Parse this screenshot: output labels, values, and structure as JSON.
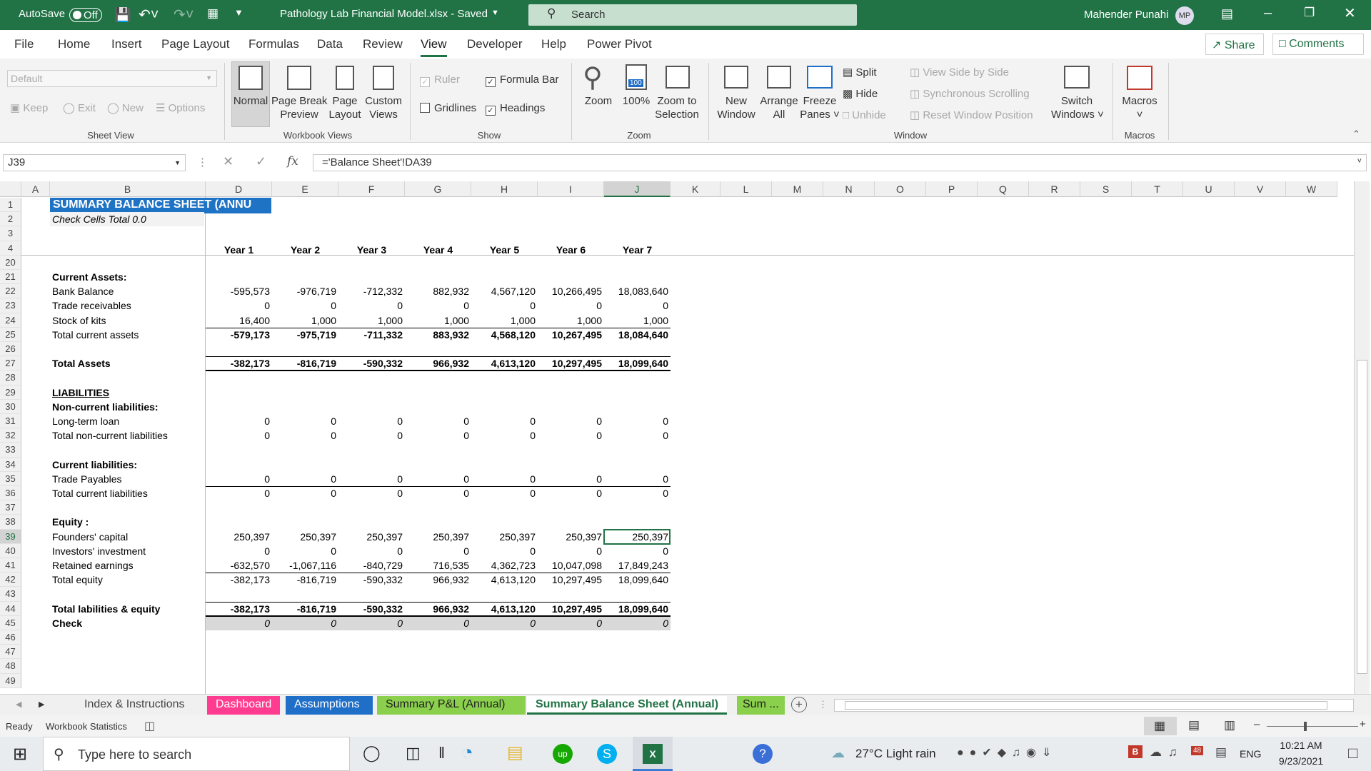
{
  "titlebar": {
    "autosave": "AutoSave",
    "autosave_state": "Off",
    "doc_title": "Pathology Lab Financial Model.xlsx  -  Saved",
    "search_placeholder": "Search",
    "user": "Mahender Punahi",
    "initials": "MP"
  },
  "menu": [
    "File",
    "Home",
    "Insert",
    "Page Layout",
    "Formulas",
    "Data",
    "Review",
    "View",
    "Developer",
    "Help",
    "Power Pivot"
  ],
  "active_menu": "View",
  "share": "Share",
  "comments": "Comments",
  "ribbon": {
    "sheet_view": {
      "dropdown": "Default",
      "keep": "Keep",
      "exit": "Exit",
      "new": "New",
      "options": "Options",
      "group": "Sheet View"
    },
    "workbook_views": {
      "normal": "Normal",
      "page_break": "Page Break",
      "page_break2": "Preview",
      "page_layout": "Page",
      "page_layout2": "Layout",
      "custom": "Custom",
      "custom2": "Views",
      "group": "Workbook Views"
    },
    "show": {
      "ruler": "Ruler",
      "formula_bar": "Formula Bar",
      "gridlines": "Gridlines",
      "headings": "Headings",
      "group": "Show"
    },
    "zoom": {
      "zoom": "Zoom",
      "hundred": "100%",
      "zoom_sel": "Zoom to",
      "zoom_sel2": "Selection",
      "icon_text": "100",
      "group": "Zoom"
    },
    "window": {
      "new": "New",
      "new2": "Window",
      "arrange": "Arrange",
      "arrange2": "All",
      "freeze": "Freeze",
      "freeze2": "Panes",
      "split": "Split",
      "hide": "Hide",
      "unhide": "Unhide",
      "side": "View Side by Side",
      "sync": "Synchronous Scrolling",
      "reset": "Reset Window Position",
      "switch": "Switch",
      "switch2": "Windows",
      "group": "Window"
    },
    "macros": {
      "label": "Macros",
      "group": "Macros"
    }
  },
  "namebox": "J39",
  "formula": "='Balance Sheet'!DA39",
  "columns": [
    "A",
    "B",
    "D",
    "E",
    "F",
    "G",
    "H",
    "I",
    "J",
    "K",
    "L",
    "M",
    "N",
    "O",
    "P",
    "Q",
    "R",
    "S",
    "T",
    "U",
    "V",
    "W"
  ],
  "rows": [
    "1",
    "2",
    "3",
    "4",
    "20",
    "21",
    "22",
    "23",
    "24",
    "25",
    "26",
    "27",
    "28",
    "29",
    "30",
    "31",
    "32",
    "33",
    "34",
    "35",
    "36",
    "37",
    "38",
    "39",
    "40",
    "41",
    "42",
    "43",
    "44",
    "45",
    "46",
    "47",
    "48",
    "49"
  ],
  "sheet": {
    "title": "SUMMARY BALANCE SHEET (ANNU",
    "check_cells": "Check Cells Total 0.0",
    "years": [
      "Year 1",
      "Year 2",
      "Year 3",
      "Year 4",
      "Year 5",
      "Year 6",
      "Year 7"
    ],
    "lines": [
      {
        "row": "21",
        "label": "Current Assets:",
        "bold": true,
        "values": []
      },
      {
        "row": "22",
        "label": "Bank Balance",
        "values": [
          "-595,573",
          "-976,719",
          "-712,332",
          "882,932",
          "4,567,120",
          "10,266,495",
          "18,083,640"
        ]
      },
      {
        "row": "23",
        "label": "Trade receivables",
        "values": [
          "0",
          "0",
          "0",
          "0",
          "0",
          "0",
          "0"
        ]
      },
      {
        "row": "24",
        "label": "Stock of kits",
        "values": [
          "16,400",
          "1,000",
          "1,000",
          "1,000",
          "1,000",
          "1,000",
          "1,000"
        ]
      },
      {
        "row": "25",
        "label": "Total current assets",
        "values": [
          "-579,173",
          "-975,719",
          "-711,332",
          "883,932",
          "4,568,120",
          "10,267,495",
          "18,084,640"
        ],
        "boldvals": true
      },
      {
        "row": "27",
        "label": "Total Assets",
        "bold": true,
        "values": [
          "-382,173",
          "-816,719",
          "-590,332",
          "966,932",
          "4,613,120",
          "10,297,495",
          "18,099,640"
        ],
        "boldvals": true
      },
      {
        "row": "29",
        "label": "LIABILITIES",
        "bold": true,
        "underline": true,
        "values": []
      },
      {
        "row": "30",
        "label": "Non-current liabilities:",
        "bold": true,
        "values": []
      },
      {
        "row": "31",
        "label": "Long-term loan",
        "values": [
          "0",
          "0",
          "0",
          "0",
          "0",
          "0",
          "0"
        ]
      },
      {
        "row": "32",
        "label": "Total non-current liabilities",
        "values": [
          "0",
          "0",
          "0",
          "0",
          "0",
          "0",
          "0"
        ]
      },
      {
        "row": "34",
        "label": "Current liabilities:",
        "bold": true,
        "values": []
      },
      {
        "row": "35",
        "label": "Trade Payables",
        "values": [
          "0",
          "0",
          "0",
          "0",
          "0",
          "0",
          "0"
        ]
      },
      {
        "row": "36",
        "label": "Total current liabilities",
        "values": [
          "0",
          "0",
          "0",
          "0",
          "0",
          "0",
          "0"
        ]
      },
      {
        "row": "38",
        "label": "Equity :",
        "bold": true,
        "values": []
      },
      {
        "row": "39",
        "label": "Founders' capital",
        "values": [
          "250,397",
          "250,397",
          "250,397",
          "250,397",
          "250,397",
          "250,397",
          "250,397"
        ]
      },
      {
        "row": "40",
        "label": "Investors' investment",
        "values": [
          "0",
          "0",
          "0",
          "0",
          "0",
          "0",
          "0"
        ]
      },
      {
        "row": "41",
        "label": "Retained earnings",
        "values": [
          "-632,570",
          "-1,067,116",
          "-840,729",
          "716,535",
          "4,362,723",
          "10,047,098",
          "17,849,243"
        ]
      },
      {
        "row": "42",
        "label": "Total equity",
        "values": [
          "-382,173",
          "-816,719",
          "-590,332",
          "966,932",
          "4,613,120",
          "10,297,495",
          "18,099,640"
        ]
      },
      {
        "row": "44",
        "label": "Total labilities & equity",
        "bold": true,
        "values": [
          "-382,173",
          "-816,719",
          "-590,332",
          "966,932",
          "4,613,120",
          "10,297,495",
          "18,099,640"
        ],
        "boldvals": true
      },
      {
        "row": "45",
        "label": "Check",
        "bold": true,
        "values": [
          "0",
          "0",
          "0",
          "0",
          "0",
          "0",
          "0"
        ],
        "italvals": true
      }
    ]
  },
  "tabs": [
    "Index & Instructions",
    "Dashboard",
    "Assumptions",
    "Summary P&L (Annual)",
    "Summary Balance Sheet (Annual)",
    "Sum ..."
  ],
  "active_tab": "Summary Balance Sheet (Annual)",
  "status": {
    "ready": "Ready",
    "workbook_stats": "Workbook Statistics"
  },
  "taskbar": {
    "search_placeholder": "Type here to search",
    "weather": "27°C  Light rain",
    "lang": "ENG",
    "time": "10:21 AM",
    "date": "9/23/2021",
    "badge": "48"
  },
  "colors": {
    "excel_green": "#217346",
    "tab_dashboard": "#ff3c8f",
    "tab_assumptions": "#1f6fc9",
    "tab_pl": "#8bd04c",
    "title_fill": "#1f73c5"
  }
}
